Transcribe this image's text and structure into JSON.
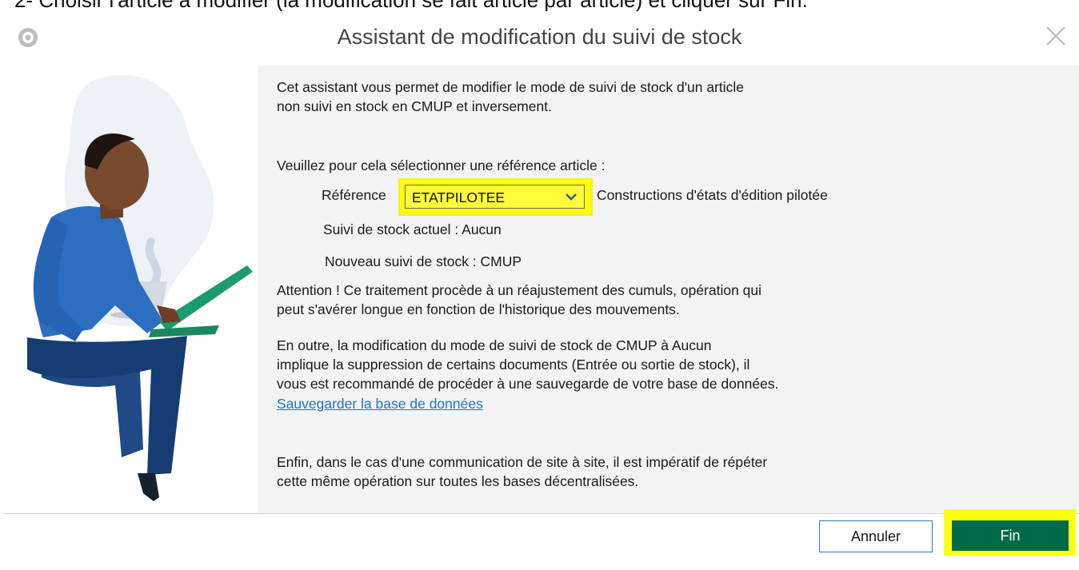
{
  "caption": "2- Choisir l'article à modifier (la modification se fait article par article) et cliquer sur Fin.",
  "window": {
    "title": "Assistant de modification du suivi de stock"
  },
  "intro": {
    "line1": "Cet assistant vous permet de modifier le mode de suivi de stock d'un article",
    "line2": "non suivi en stock en CMUP et inversement."
  },
  "select_prompt": "Veuillez pour cela sélectionner une référence article :",
  "reference": {
    "label": "Référence",
    "value": "ETATPILOTEE",
    "description": "Constructions d'états d'édition pilotée"
  },
  "current_tracking": "Suivi de stock actuel : Aucun",
  "new_tracking": "Nouveau suivi de stock : CMUP",
  "warning": {
    "line1": "Attention ! Ce traitement procède à un réajustement des cumuls, opération qui",
    "line2": "peut s'avérer longue en fonction de l'historique des mouvements."
  },
  "note": {
    "line1": "En outre, la modification du mode de suivi de stock de CMUP à Aucun",
    "line2": "implique la suppression de certains documents (Entrée ou sortie de stock), il",
    "line3": "vous est recommandé de procéder à une sauvegarde de votre base de données."
  },
  "backup_link": "Sauvegarder la base de données",
  "final": {
    "line1": "Enfin, dans le cas d'une communication de site à site, il est impératif de répéter",
    "line2": "cette même opération sur toutes les bases décentralisées."
  },
  "buttons": {
    "cancel": "Annuler",
    "finish": "Fin"
  },
  "icons": {
    "app": "app-logo-icon",
    "close": "close-icon",
    "dropdown": "chevron-down-icon"
  },
  "colors": {
    "finish_button": "#006a48",
    "highlight": "#ffff00",
    "link": "#1a78c2"
  }
}
